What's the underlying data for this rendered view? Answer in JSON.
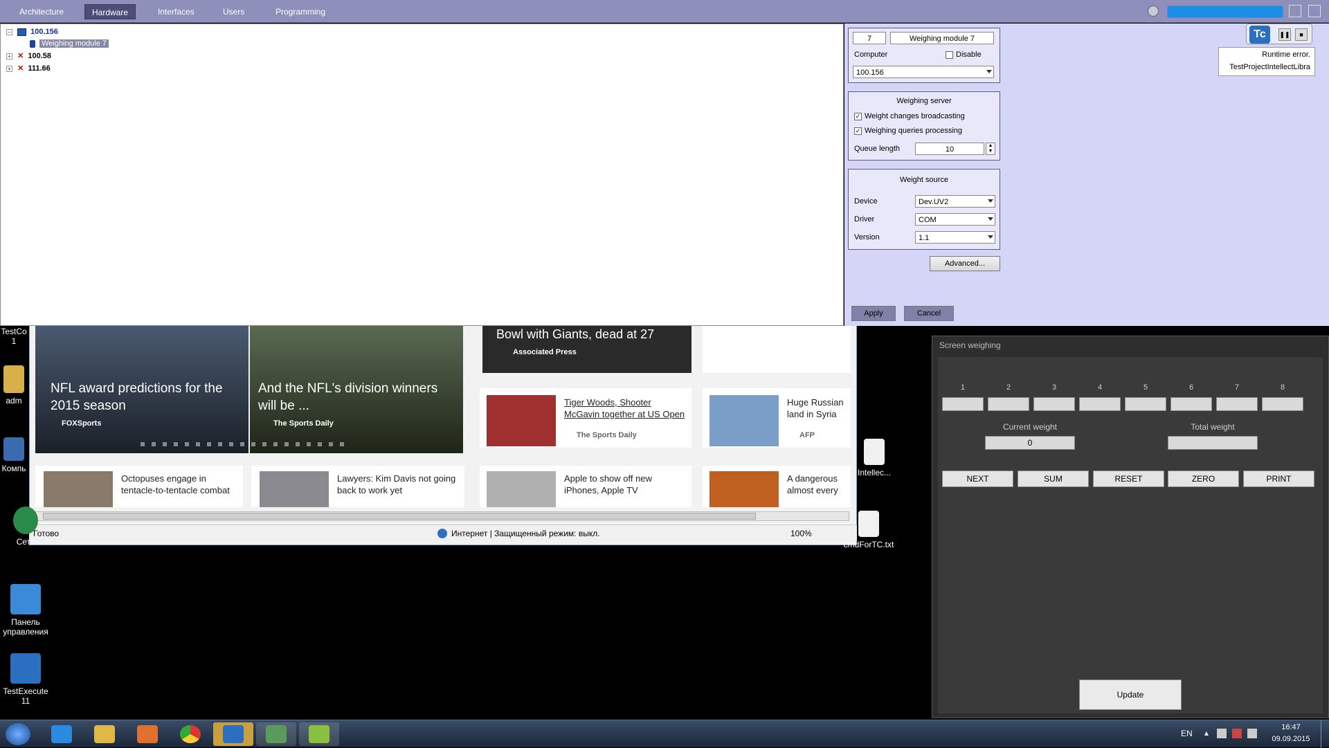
{
  "menu": {
    "tabs": [
      "Architecture",
      "Hardware",
      "Interfaces",
      "Users",
      "Programming"
    ],
    "active_tab": "Hardware"
  },
  "tree": {
    "nodes": [
      {
        "label": "100.156",
        "expander": "−",
        "status": "online"
      },
      {
        "label": "Weighing module 7",
        "child": true,
        "selected": true
      },
      {
        "label": "100.58",
        "expander": "+",
        "status": "error"
      },
      {
        "label": "111.66",
        "expander": "+",
        "status": "error"
      }
    ]
  },
  "properties": {
    "id": "7",
    "name": "Weighing module 7",
    "computer_label": "Computer",
    "disable_label": "Disable",
    "computer_value": "100.156",
    "server": {
      "title": "Weighing server",
      "broadcast_label": "Weight changes broadcasting",
      "queries_label": "Weighing queries processing",
      "queue_label": "Queue length",
      "queue_value": "10"
    },
    "source": {
      "title": "Weight source",
      "device_label": "Device",
      "device_value": "Dev.UV2",
      "driver_label": "Driver",
      "driver_value": "COM",
      "version_label": "Version",
      "version_value": "1.1"
    },
    "advanced_label": "Advanced...",
    "apply_label": "Apply",
    "cancel_label": "Cancel"
  },
  "runtime": {
    "error_label": "Runtime error.",
    "project_label": "TestProjectIntellectLibra"
  },
  "browser": {
    "hero1_title": "NFL award predictions for the 2015 season",
    "hero1_src": "FOXSports",
    "hero2_title": "And the NFL's division winners will be ...",
    "hero2_src": "The Sports Daily",
    "top_title": "Bowl with Giants, dead at 27",
    "top_src": "Associated Press",
    "card1_title": "Tiger Woods, Shooter McGavin together at US Open",
    "card1_src": "The Sports Daily",
    "card2_title": "Huge Russian land in Syria",
    "card2_src": "AFP",
    "card3_title": "Octopuses engage in tentacle-to-tentacle combat",
    "card4_title": "Lawyers: Kim Davis not going back to work yet",
    "card5_title": "Apple to show off new iPhones, Apple TV",
    "card6_title": "A dangerous almost every",
    "status_ready": "Готово",
    "status_zone": "Интернет | Защищенный режим: выкл.",
    "zoom": "100%"
  },
  "desktop": {
    "icons": [
      "adm",
      "Компь",
      "Сеть",
      "Панель управления",
      "TestExecute 11",
      "Intellec...",
      "cmdForTC.txt",
      "TestCo 1"
    ]
  },
  "weighing": {
    "title": "Screen weighing",
    "cells": [
      "1",
      "2",
      "3",
      "4",
      "5",
      "6",
      "7",
      "8"
    ],
    "current_label": "Current weight",
    "current_value": "0",
    "total_label": "Total weight",
    "buttons": [
      "NEXT",
      "SUM",
      "RESET",
      "ZERO",
      "PRINT"
    ],
    "update_label": "Update"
  },
  "taskbar": {
    "lang": "EN",
    "time": "16:47",
    "date": "09.09.2015"
  },
  "colors": {
    "menu_bg": "#8f8fbc",
    "props_bg": "#d5d5f8",
    "weigh_bg": "#2e2e2e",
    "error_red": "#d00000",
    "online_blue": "#1030a0"
  }
}
